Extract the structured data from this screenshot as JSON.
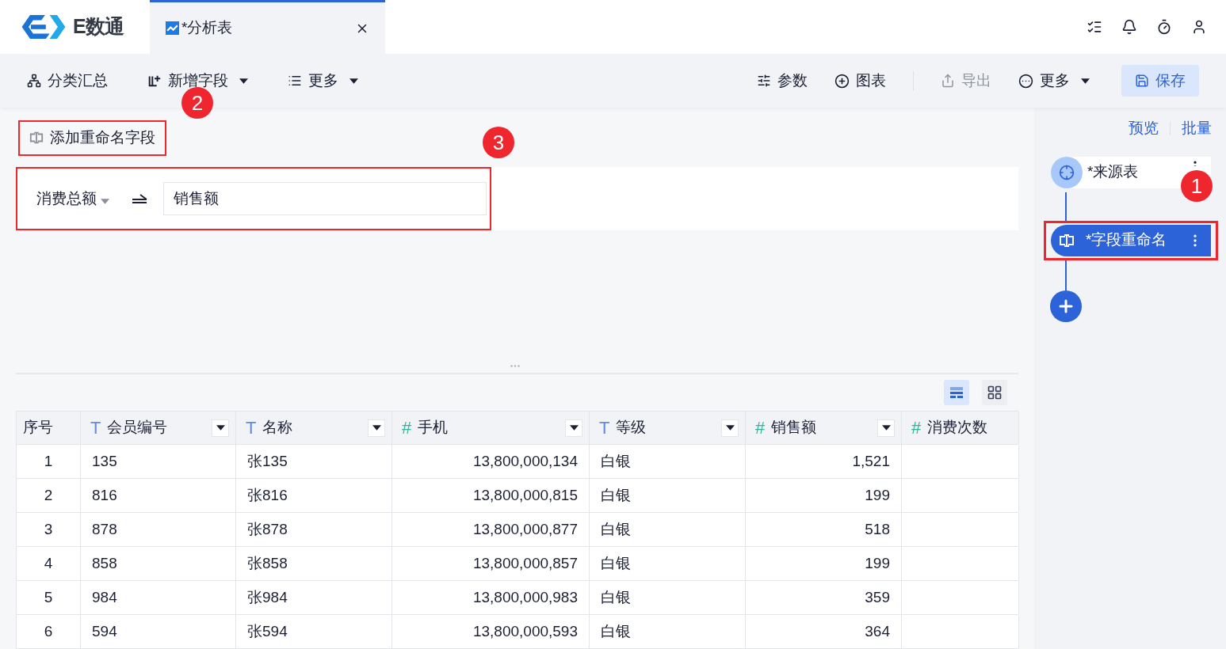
{
  "app": {
    "logo_text": "E数通"
  },
  "tab": {
    "title": "*分析表",
    "selected": true
  },
  "toolbar": {
    "left": [
      {
        "label": "分类汇总",
        "dropdown": false
      },
      {
        "label": "新增字段",
        "dropdown": true
      },
      {
        "label": "更多",
        "dropdown": true
      }
    ],
    "right": [
      {
        "label": "参数",
        "kind": "plain",
        "disabled": false,
        "dropdown": false
      },
      {
        "label": "图表",
        "kind": "plain",
        "disabled": false,
        "dropdown": false
      },
      {
        "label": "导出",
        "kind": "plain",
        "disabled": true,
        "dropdown": false
      },
      {
        "label": "更多",
        "kind": "plain",
        "disabled": false,
        "dropdown": true
      },
      {
        "label": "保存",
        "kind": "primary",
        "disabled": false,
        "dropdown": false
      }
    ]
  },
  "editor": {
    "add_button": {
      "label": "添加重命名字段",
      "highlighted": true
    },
    "rename": {
      "source_field": "消费总额",
      "new_name": "销售额",
      "highlighted": true
    }
  },
  "view_toggle": [
    {
      "kind": "list",
      "selected": true
    },
    {
      "kind": "grid",
      "selected": false
    }
  ],
  "table": {
    "columns": [
      {
        "label": "序号",
        "kind": "index",
        "dropdown": false
      },
      {
        "label": "会员编号",
        "kind": "text",
        "type_mark": "T",
        "dropdown": true
      },
      {
        "label": "名称",
        "kind": "text",
        "type_mark": "T",
        "dropdown": true
      },
      {
        "label": "手机",
        "kind": "number",
        "type_mark": "#",
        "dropdown": true
      },
      {
        "label": "等级",
        "kind": "text",
        "type_mark": "T",
        "dropdown": true
      },
      {
        "label": "销售额",
        "kind": "number",
        "type_mark": "#",
        "dropdown": true
      },
      {
        "label": "消费次数",
        "kind": "number",
        "type_mark": "#",
        "dropdown": false
      }
    ],
    "rows": [
      [
        "1",
        "135",
        "张135",
        "13,800,000,134",
        "白银",
        "1,521"
      ],
      [
        "2",
        "816",
        "张816",
        "13,800,000,815",
        "白银",
        "199"
      ],
      [
        "3",
        "878",
        "张878",
        "13,800,000,877",
        "白银",
        "518"
      ],
      [
        "4",
        "858",
        "张858",
        "13,800,000,857",
        "白银",
        "199"
      ],
      [
        "5",
        "984",
        "张984",
        "13,800,000,983",
        "白银",
        "359"
      ],
      [
        "6",
        "594",
        "张594",
        "13,800,000,593",
        "白银",
        "364"
      ]
    ]
  },
  "flow": {
    "links": [
      "预览",
      "批量"
    ],
    "nodes": [
      {
        "label": "*来源表",
        "kind": "source",
        "selected": false,
        "highlighted": false
      },
      {
        "label": "*字段重命名",
        "kind": "rename",
        "selected": true,
        "highlighted": true
      }
    ]
  },
  "callouts": [
    "1",
    "2",
    "3"
  ]
}
